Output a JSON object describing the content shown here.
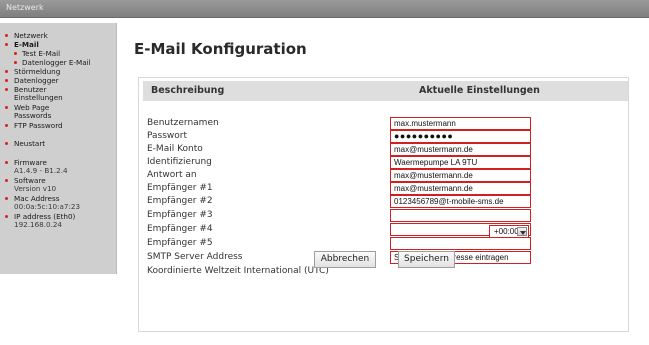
{
  "topbar": {
    "title": "Netzwerk"
  },
  "sidebar": {
    "items": [
      {
        "label": "Netzwerk"
      },
      {
        "label": "E-Mail"
      },
      {
        "label": "Test E-Mail"
      },
      {
        "label": "Datenlogger E-Mail"
      },
      {
        "label": "Störmeldung"
      },
      {
        "label": "Datenlogger"
      },
      {
        "label": "Benutzer",
        "label2": "Einstellungen"
      },
      {
        "label": "Web Page",
        "label2": "Passwords"
      },
      {
        "label": "FTP Password"
      },
      {
        "label": "Neustart"
      },
      {
        "label": "Firmware",
        "value": "A1.4.9 - B1.2.4"
      },
      {
        "label": "Software",
        "value": "Version v10"
      },
      {
        "label": "Mac Address",
        "value": "00:0a:5c:10:a7:23"
      },
      {
        "label": "IP address (Eth0)",
        "value": "192.168.0.24"
      }
    ]
  },
  "main": {
    "title": "E-Mail Konfiguration",
    "header": {
      "left": "Beschreibung",
      "right": "Aktuelle Einstellungen"
    },
    "rows": [
      {
        "label": "Benutzernamen",
        "value": "max.mustermann"
      },
      {
        "label": "Passwort",
        "value": "●●●●●●●●●●"
      },
      {
        "label": "E-Mail Konto",
        "value": "max@mustermann.de"
      },
      {
        "label": "Identifizierung",
        "value": "Waermepumpe LA 9TU"
      },
      {
        "label": "Antwort an",
        "value": "max@mustermann.de"
      },
      {
        "label": "Empfänger #1",
        "value": "max@mustermann.de"
      },
      {
        "label": "Empfänger #2",
        "value": "0123456789@t-mobile-sms.de"
      },
      {
        "label": "Empfänger #3",
        "value": ""
      },
      {
        "label": "Empfänger #4",
        "value": ""
      },
      {
        "label": "Empfänger #5",
        "value": ""
      },
      {
        "label": "SMTP Server Address",
        "value": "SMTP Server Adresse eintragen"
      }
    ],
    "timezone": {
      "label": "Koordinierte Weltzeit International (UTC)",
      "value": "+00:00"
    },
    "buttons": {
      "cancel": "Abbrechen",
      "save": "Speichern"
    }
  }
}
